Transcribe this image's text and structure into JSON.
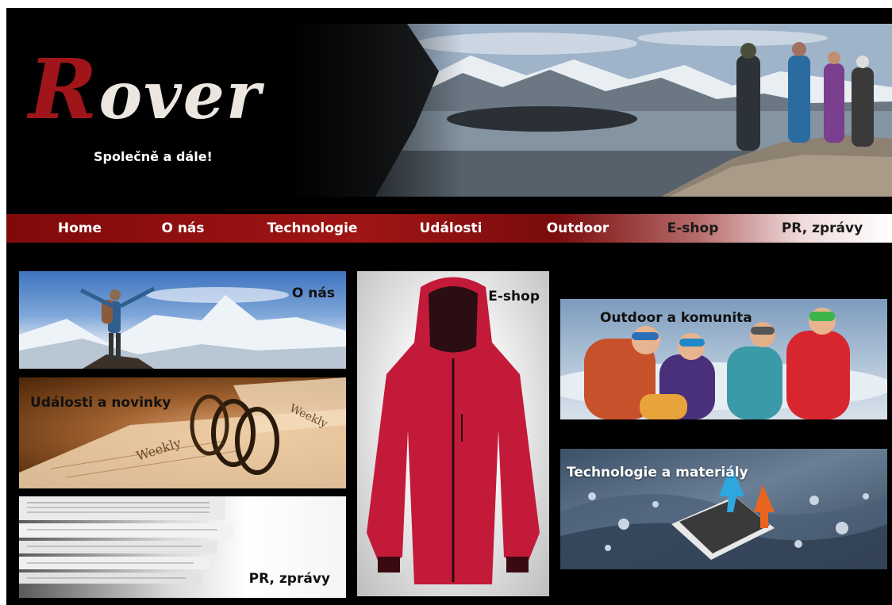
{
  "brand": {
    "logo_initial": "R",
    "logo_rest": "over",
    "slogan": "Společně a dále!"
  },
  "nav": {
    "items": [
      "Home",
      "O nás",
      "Technologie",
      "Události",
      "Outdoor",
      "E-shop",
      "PR, zprávy"
    ]
  },
  "tiles": {
    "onas": "O nás",
    "udalosti": "Události a novinky",
    "pr": "PR, zprávy",
    "eshop": "E-shop",
    "outdoor": "Outdoor a komunita",
    "technologie": "Technologie a materiály",
    "weekly_text": "Weekly"
  },
  "colors": {
    "brand_red": "#a0151a",
    "nav_red": "#8a0e0e",
    "background": "#000000"
  }
}
